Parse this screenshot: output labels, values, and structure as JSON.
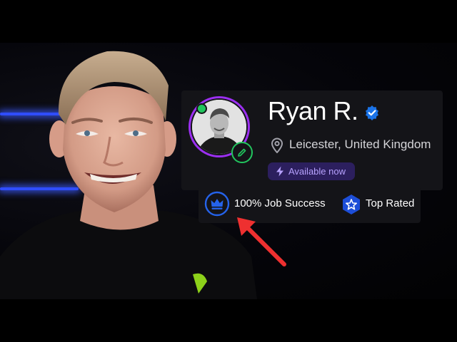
{
  "profile": {
    "name": "Ryan R.",
    "location": "Leicester, United Kingdom",
    "availability": "Available now",
    "status": "online",
    "verified": true
  },
  "stats": {
    "job_success": "100% Job Success",
    "top_rated": "Top Rated"
  },
  "icons": {
    "verified": "verified-check-icon",
    "location": "map-pin-icon",
    "availability": "lightning-bolt-icon",
    "edit_photo": "pencil-icon",
    "job_success": "crown-icon",
    "top_rated": "star-badge-icon",
    "annotation": "red-arrow-icon"
  },
  "colors": {
    "card_bg": "#141418",
    "avatar_ring": "#9b2ff0",
    "online": "#21c55d",
    "verified": "#1a73e8",
    "availability_bg": "#2c1f5e",
    "availability_text": "#b7a2ff",
    "job_success_icon": "#2563eb",
    "top_rated_icon": "#1d4ed8",
    "arrow": "#ee3030",
    "neon": "#2f4dff"
  }
}
